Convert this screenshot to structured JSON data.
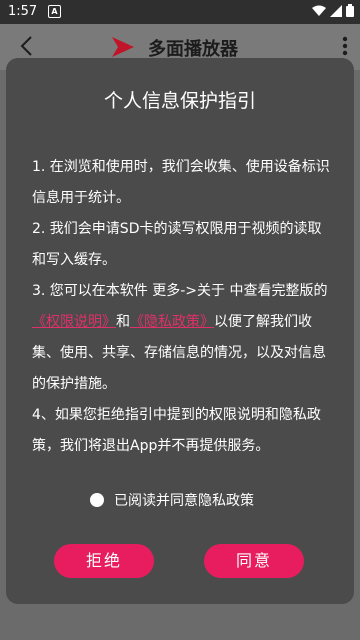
{
  "status_bar": {
    "time": "1:57",
    "notification_label": "A"
  },
  "app_bar": {
    "title": "多面播放器"
  },
  "dialog": {
    "title": "个人信息保护指引",
    "paragraphs": {
      "p1": "1. 在浏览和使用时，我们会收集、使用设备标识信息用于统计。",
      "p2": "2. 我们会申请SD卡的读写权限用于视频的读取和写入缓存。",
      "p3_prefix": "3. 您可以在本软件 更多->关于 中查看完整版的",
      "p3_link1": "《权限说明》",
      "p3_and": "和",
      "p3_link2": "《隐私政策》",
      "p3_suffix": "以便了解我们收集、使用、共享、存储信息的情况，以及对信息的保护措施。",
      "p4": "4、如果您拒绝指引中提到的权限说明和隐私政策，我们将退出App并不再提供服务。"
    },
    "agree_label": "已阅读并同意隐私政策",
    "reject_label": "拒绝",
    "accept_label": "同意"
  },
  "colors": {
    "accent": "#e81d5f",
    "dialog_bg": "#4b4b4b",
    "link": "#e0306a"
  }
}
